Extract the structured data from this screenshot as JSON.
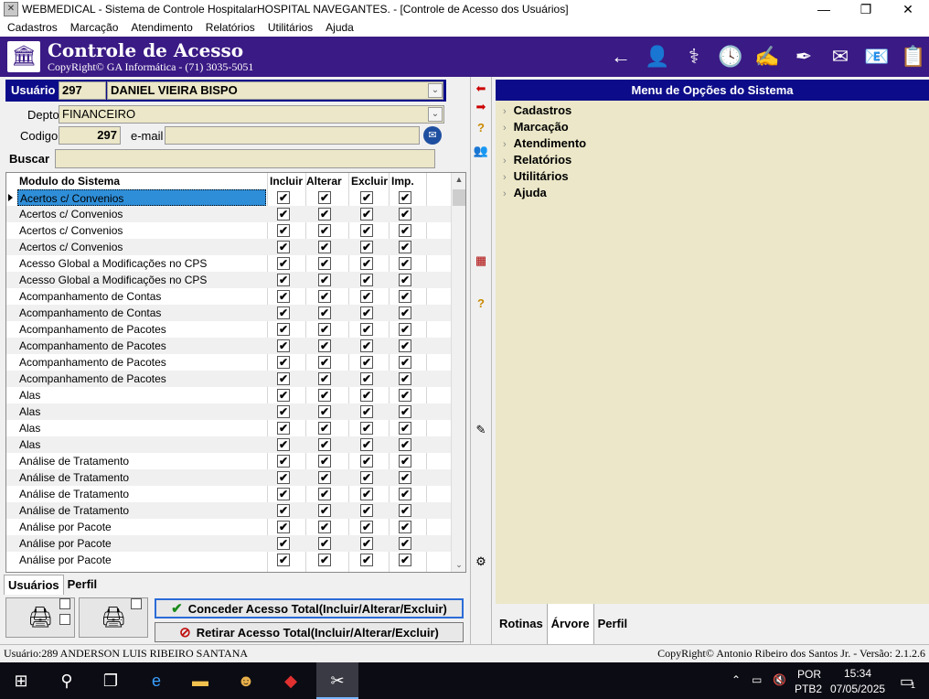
{
  "window": {
    "title": "WEBMEDICAL - Sistema de Controle HospitalarHOSPITAL NAVEGANTES. - [Controle de Acesso dos Usuários]",
    "minimize": "—",
    "restore": "❐",
    "close": "✕"
  },
  "menu": [
    "Cadastros",
    "Marcação",
    "Atendimento",
    "Relatórios",
    "Utilitários",
    "Ajuda"
  ],
  "banner": {
    "title": "Controle de Acesso",
    "subtitle": "CopyRight© GA Informática - (71) 3035-5051",
    "tools": [
      {
        "icon": "back-arrow-icon",
        "glyph": "←"
      },
      {
        "icon": "users-icon",
        "glyph": "👤"
      },
      {
        "icon": "medical-caduceus-icon",
        "glyph": "⚕"
      },
      {
        "icon": "clock-icon",
        "glyph": "🕓"
      },
      {
        "icon": "sign-icon",
        "glyph": "✍"
      },
      {
        "icon": "signature-icon",
        "glyph": "✒"
      },
      {
        "icon": "sms-icon",
        "glyph": "✉"
      },
      {
        "icon": "email-icon",
        "glyph": "📧"
      },
      {
        "icon": "report-icon",
        "glyph": "📋"
      }
    ]
  },
  "form": {
    "usuario_label": "Usuário",
    "usuario_code": "297",
    "usuario_name": "DANIEL VIEIRA BISPO",
    "depto_label": "Depto",
    "depto_value": "FINANCEIRO",
    "codigo_label": "Codigo",
    "codigo_value": "297",
    "email_label": "e-mail",
    "email_value": "",
    "buscar_label": "Buscar",
    "buscar_value": ""
  },
  "grid": {
    "headers": {
      "module": "Modulo do Sistema",
      "incluir": "Incluir",
      "alterar": "Alterar",
      "excluir": "Excluir",
      "imp": "Imp."
    },
    "check": "✔",
    "rows": [
      "Acertos c/ Convenios",
      "Acertos c/ Convenios",
      "Acertos c/ Convenios",
      "Acertos c/ Convenios",
      "Acesso Global a Modificações no CPS",
      "Acesso Global a Modificações no CPS",
      "Acompanhamento de Contas",
      "Acompanhamento de Contas",
      "Acompanhamento de Pacotes",
      "Acompanhamento de Pacotes",
      "Acompanhamento de Pacotes",
      "Acompanhamento de Pacotes",
      "Alas",
      "Alas",
      "Alas",
      "Alas",
      "Análise de Tratamento",
      "Análise de Tratamento",
      "Análise de Tratamento",
      "Análise de Tratamento",
      "Análise por Pacote",
      "Análise por Pacote",
      "Análise por Pacote"
    ]
  },
  "left_tabs": [
    "Usuários",
    "Perfil"
  ],
  "actions": {
    "grant": "Conceder Acesso Total(Incluir/Alterar/Excluir)",
    "revoke": "Retirar Acesso Total(Incluir/Alterar/Excluir)"
  },
  "right_panel": {
    "title": "Menu de Opções do Sistema",
    "tree": [
      "Cadastros",
      "Marcação",
      "Atendimento",
      "Relatórios",
      "Utilitários",
      "Ajuda"
    ],
    "tabs": [
      "Rotinas",
      "Árvore",
      "Perfil"
    ]
  },
  "status": {
    "left": "Usuário:289 ANDERSON LUIS RIBEIRO SANTANA",
    "right": "CopyRight© Antonio Ribeiro dos Santos Jr. - Versão: 2.1.2.6"
  },
  "taskbar": {
    "lang1": "POR",
    "lang2": "PTB2",
    "time": "15:34",
    "date": "07/05/2025",
    "notif_count": "1"
  }
}
